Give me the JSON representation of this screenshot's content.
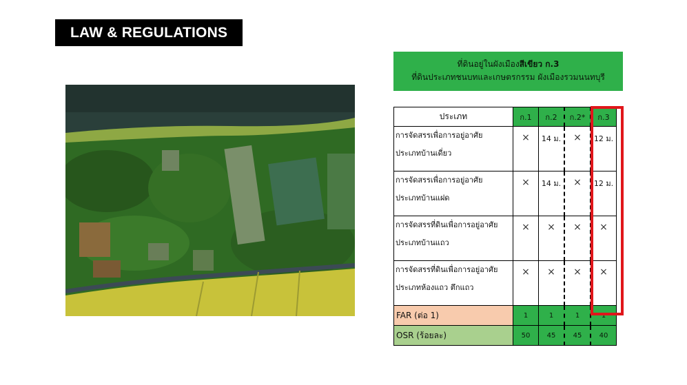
{
  "header": {
    "title": "LAW & REGULATIONS"
  },
  "zone_box": {
    "line1_prefix": "ที่ดินอยู่ในผังเมือง",
    "line1_bold": "สีเขียว ก.3",
    "line2": "ที่ดินประเภทชนบทและเกษตรกรรม ผังเมืองรวมนนทบุรี"
  },
  "table": {
    "type_header": "ประเภท",
    "zones": [
      "ก.1",
      "ก.2",
      "ก.2*",
      "ก.3"
    ],
    "rows": [
      {
        "line1": "การจัดสรรเพื่อการอยู่อาศัย",
        "line2": "ประเภทบ้านเดี่ยว",
        "values": [
          "×",
          "14 ม.",
          "×",
          "12 ม."
        ]
      },
      {
        "line1": "การจัดสรรเพื่อการอยู่อาศัย",
        "line2": "ประเภทบ้านแฝด",
        "values": [
          "×",
          "14 ม.",
          "×",
          "12 ม."
        ]
      },
      {
        "line1": "การจัดสรรที่ดินเพื่อการอยู่อาศัย",
        "line2": "ประเภทบ้านแถว",
        "values": [
          "×",
          "×",
          "×",
          "×"
        ]
      },
      {
        "line1": "การจัดสรรที่ดินเพื่อการอยู่อาศัย",
        "line2": "ประเภทห้องแถว ตึกแถว",
        "values": [
          "×",
          "×",
          "×",
          "×"
        ]
      }
    ],
    "far": {
      "label": "FAR (ต่อ 1)",
      "values": [
        "1",
        "1",
        "1",
        "1"
      ]
    },
    "osr": {
      "label": "OSR (ร้อยละ)",
      "values": [
        "50",
        "45",
        "45",
        "40"
      ]
    },
    "highlight_color": "#e0161b",
    "zone_color": "#2fb04a"
  },
  "map": {
    "image": "aerial-site-map"
  }
}
